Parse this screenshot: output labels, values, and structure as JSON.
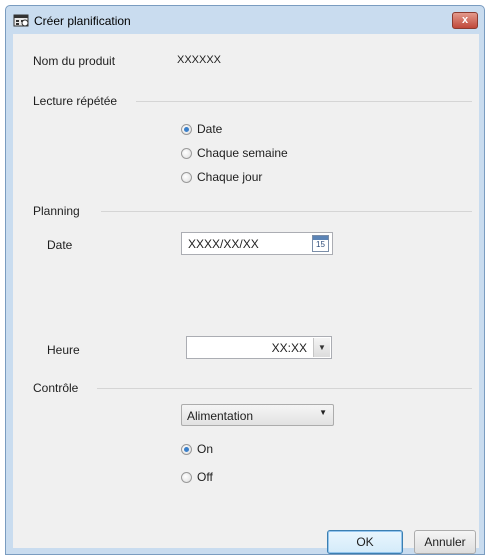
{
  "window": {
    "title": "Créer planification",
    "close_label": "x"
  },
  "product": {
    "label": "Nom du produit",
    "value": "XXXXXX"
  },
  "repeat": {
    "group_label": "Lecture répétée",
    "options": [
      {
        "label": "Date",
        "checked": true
      },
      {
        "label": "Chaque semaine",
        "checked": false
      },
      {
        "label": "Chaque jour",
        "checked": false
      }
    ]
  },
  "planning": {
    "group_label": "Planning",
    "date_label": "Date",
    "date_value": "XXXX/XX/XX",
    "calendar_day": "15",
    "time_label": "Heure",
    "time_value": "XX:XX"
  },
  "control": {
    "group_label": "Contrôle",
    "action_selected": "Alimentation",
    "options": [
      {
        "label": "On",
        "checked": true
      },
      {
        "label": "Off",
        "checked": false
      }
    ]
  },
  "buttons": {
    "ok": "OK",
    "cancel": "Annuler"
  },
  "icons": {
    "window": "schedule-app-icon",
    "calendar": "calendar-icon",
    "dropdown": "chevron-down-icon",
    "close": "close-icon"
  },
  "colors": {
    "accent": "#3a7fc9",
    "titlebar": "#c9dcef",
    "close": "#c0483a"
  }
}
